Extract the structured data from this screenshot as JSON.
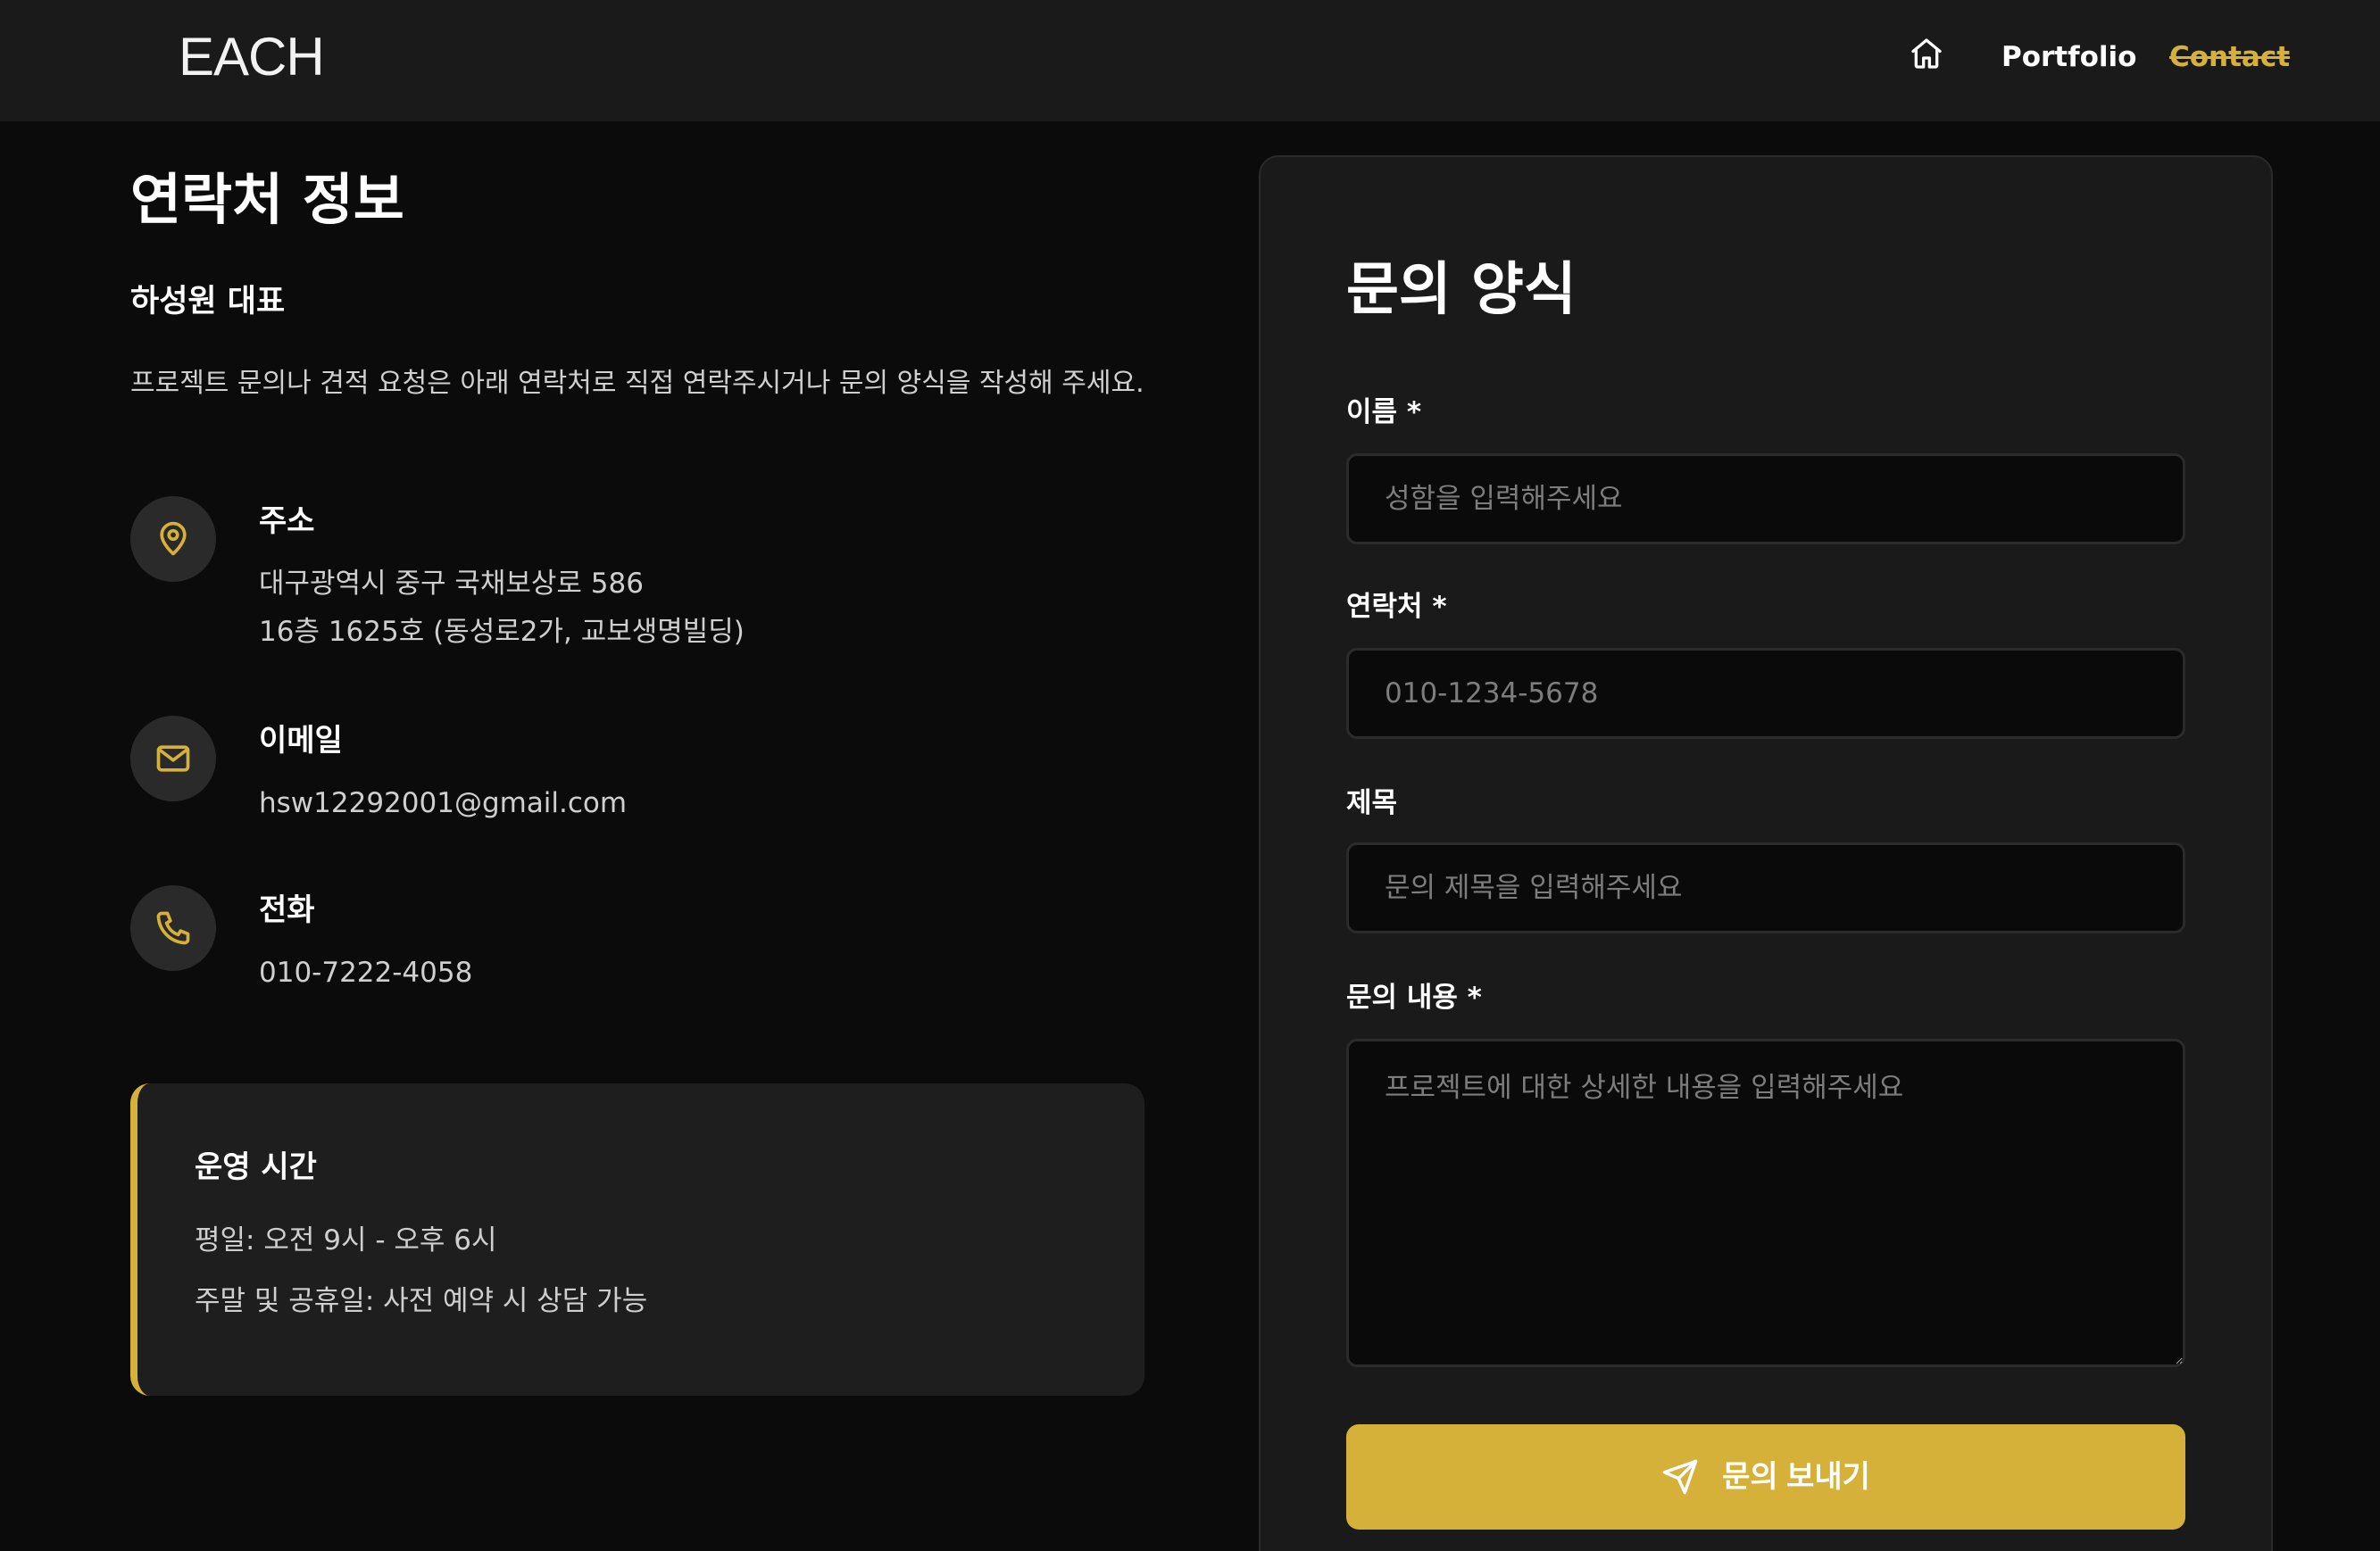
{
  "header": {
    "logo": "EACH",
    "nav": {
      "home_icon": "home-icon",
      "portfolio": "Portfolio",
      "contact": "Contact"
    }
  },
  "contact_info": {
    "title": "연락처 정보",
    "subtitle": "하성원 대표",
    "description": "프로젝트 문의나 견적 요청은 아래 연락처로 직접 연락주시거나 문의 양식을 작성해 주세요.",
    "items": [
      {
        "icon": "map-pin-icon",
        "label": "주소",
        "lines": [
          "대구광역시 중구 국채보상로 586",
          "16층 1625호 (동성로2가, 교보생명빌딩)"
        ]
      },
      {
        "icon": "mail-icon",
        "label": "이메일",
        "lines": [
          "hsw12292001@gmail.com"
        ]
      },
      {
        "icon": "phone-icon",
        "label": "전화",
        "lines": [
          "010-7222-4058"
        ]
      }
    ],
    "hours": {
      "title": "운영 시간",
      "weekday": "평일: 오전 9시 - 오후 6시",
      "weekend": "주말 및 공휴일: 사전 예약 시 상담 가능"
    }
  },
  "form": {
    "title": "문의 양식",
    "fields": {
      "name": {
        "label": "이름 *",
        "placeholder": "성함을 입력해주세요",
        "value": ""
      },
      "phone": {
        "label": "연락처 *",
        "placeholder": "010-1234-5678",
        "value": ""
      },
      "subject": {
        "label": "제목",
        "placeholder": "문의 제목을 입력해주세요",
        "value": ""
      },
      "message": {
        "label": "문의 내용 *",
        "placeholder": "프로젝트에 대한 상세한 내용을 입력해주세요",
        "value": ""
      }
    },
    "submit": {
      "label": "문의 보내기",
      "icon": "send-icon"
    }
  },
  "colors": {
    "accent": "#d6b13a",
    "header_bg": "#1a1a1a",
    "page_bg": "#0b0b0b",
    "card_bg": "#1a1a1a",
    "input_bg": "#0a0a0a"
  }
}
